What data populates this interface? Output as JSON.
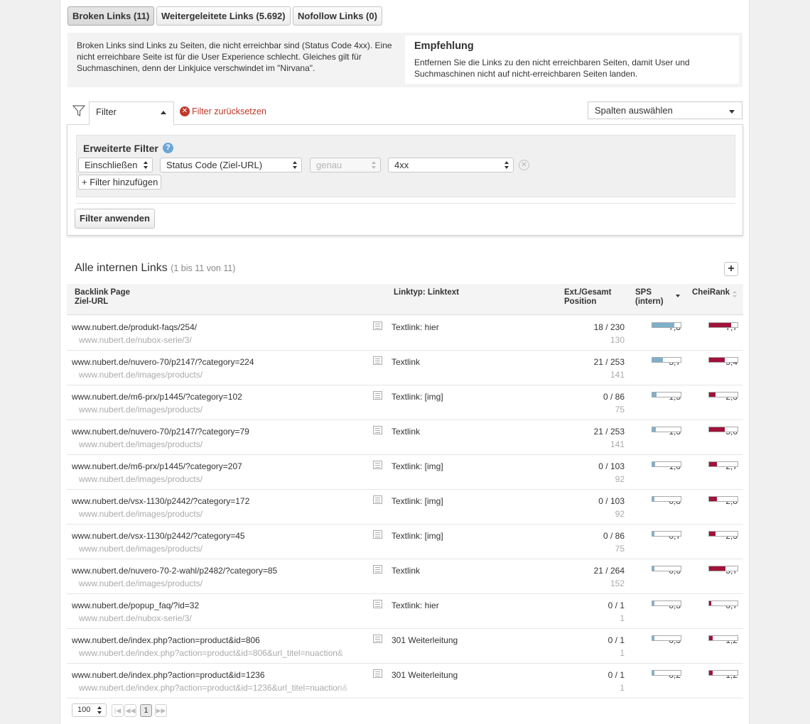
{
  "tabs": [
    {
      "label": "Broken Links (11)"
    },
    {
      "label": "Weitergeleitete Links (5.692)"
    },
    {
      "label": "Nofollow Links (0)"
    }
  ],
  "info": {
    "description": "Broken Links sind Links zu Seiten, die nicht erreichbar sind (Status Code 4xx). Eine nicht erreichbare Seite ist für die User Experience schlecht. Gleiches gilt für Suchmaschinen, denn der Linkjuice verschwindet im \"Nirvana\".",
    "recommendation_title": "Empfehlung",
    "recommendation_text": "Entfernen Sie die Links zu den nicht erreichbaren Seiten, damit User und Suchmaschinen nicht auf nicht-erreichbaren Seiten landen."
  },
  "filter": {
    "tab_label": "Filter",
    "reset_label": "Filter zurücksetzen",
    "columns_select": "Spalten auswählen",
    "advanced_title": "Erweiterte Filter",
    "help_glyph": "?",
    "include_value": "Einschließen",
    "field_value": "Status Code (Ziel-URL)",
    "operator_placeholder": "genau",
    "value": "4xx",
    "add_label": "+ Filter hinzufügen",
    "apply_label": "Filter anwenden"
  },
  "table": {
    "title": "Alle internen Links",
    "range": "(1 bis 11 von 11)",
    "plus_label": "+",
    "headers": {
      "col1_line1": "Backlink Page",
      "col1_line2": "Ziel-URL",
      "col2": "Linktyp: Linktext",
      "col3_line1": "Ext./Gesamt",
      "col3_line2": "Position",
      "col4_line1": "SPS",
      "col4_line2": "(intern)",
      "col5": "CheiRank"
    },
    "rows": [
      {
        "url": "www.nubert.de/produkt-faqs/254/",
        "target": "www.nubert.de/nubox-serie/3/",
        "type": "Textlink: hier",
        "ext": "18 / 230",
        "pos": "130",
        "sps": "7,8",
        "sps_pct": 0.78,
        "cr": "7,7",
        "cr_pct": 0.77
      },
      {
        "url": "www.nubert.de/nuvero-70/p2147/?category=224",
        "target": "www.nubert.de/images/products/",
        "type": "Textlink",
        "ext": "21 / 253",
        "pos": "141",
        "sps": "3,7",
        "sps_pct": 0.37,
        "cr": "5,4",
        "cr_pct": 0.54
      },
      {
        "url": "www.nubert.de/m6-prx/p1445/?category=102",
        "target": "www.nubert.de/images/products/",
        "type": "Textlink: [img]",
        "ext": "0 / 86",
        "pos": "75",
        "sps": "1,5",
        "sps_pct": 0.15,
        "cr": "2,3",
        "cr_pct": 0.23
      },
      {
        "url": "www.nubert.de/nuvero-70/p2147/?category=79",
        "target": "www.nubert.de/images/products/",
        "type": "Textlink",
        "ext": "21 / 253",
        "pos": "141",
        "sps": "1,3",
        "sps_pct": 0.13,
        "cr": "5,6",
        "cr_pct": 0.56
      },
      {
        "url": "www.nubert.de/m6-prx/p1445/?category=207",
        "target": "www.nubert.de/images/products/",
        "type": "Textlink: [img]",
        "ext": "0 / 103",
        "pos": "92",
        "sps": "1,0",
        "sps_pct": 0.1,
        "cr": "2,7",
        "cr_pct": 0.27
      },
      {
        "url": "www.nubert.de/vsx-1130/p2442/?category=172",
        "target": "www.nubert.de/images/products/",
        "type": "Textlink: [img]",
        "ext": "0 / 103",
        "pos": "92",
        "sps": "0,8",
        "sps_pct": 0.08,
        "cr": "2,8",
        "cr_pct": 0.28
      },
      {
        "url": "www.nubert.de/vsx-1130/p2442/?category=45",
        "target": "www.nubert.de/images/products/",
        "type": "Textlink: [img]",
        "ext": "0 / 86",
        "pos": "75",
        "sps": "0,7",
        "sps_pct": 0.07,
        "cr": "2,3",
        "cr_pct": 0.23
      },
      {
        "url": "www.nubert.de/nuvero-70-2-wahl/p2482/?category=85",
        "target": "www.nubert.de/images/products/",
        "type": "Textlink",
        "ext": "21 / 264",
        "pos": "152",
        "sps": "0,6",
        "sps_pct": 0.06,
        "cr": "5,7",
        "cr_pct": 0.57
      },
      {
        "url": "www.nubert.de/popup_faq/?id=32",
        "target": "www.nubert.de/nubox-serie/3/",
        "type": "Textlink: hier",
        "ext": "0 / 1",
        "pos": "1",
        "sps": "0,3",
        "sps_pct": 0.03,
        "cr": "0,7",
        "cr_pct": 0.07
      },
      {
        "url": "www.nubert.de/index.php?action=product&id=806",
        "target": "www.nubert.de/index.php?action=product&id=806&url_titel=nuaction&",
        "type": "301 Weiterleitung",
        "ext": "0 / 1",
        "pos": "1",
        "sps": "0,3",
        "sps_pct": 0.03,
        "cr": "1,2",
        "cr_pct": 0.12
      },
      {
        "url": "www.nubert.de/index.php?action=product&id=1236",
        "target": "www.nubert.de/index.php?action=product&id=1236&url_titel=nuaction&",
        "type": "301 Weiterleitung",
        "ext": "0 / 1",
        "pos": "1",
        "sps": "0,2",
        "sps_pct": 0.02,
        "cr": "1,2",
        "cr_pct": 0.12
      }
    ]
  },
  "pagination": {
    "per_page": "100",
    "current_page": "1",
    "first_glyph": "|◀",
    "prev_glyph": "◀◀",
    "next_glyph": "▶▶"
  },
  "colors": {
    "sps_bar": "#7fb0cb",
    "cheirank_bar": "#a0123a",
    "reset_red": "#c0392b",
    "help_blue": "#6ba7d6"
  }
}
